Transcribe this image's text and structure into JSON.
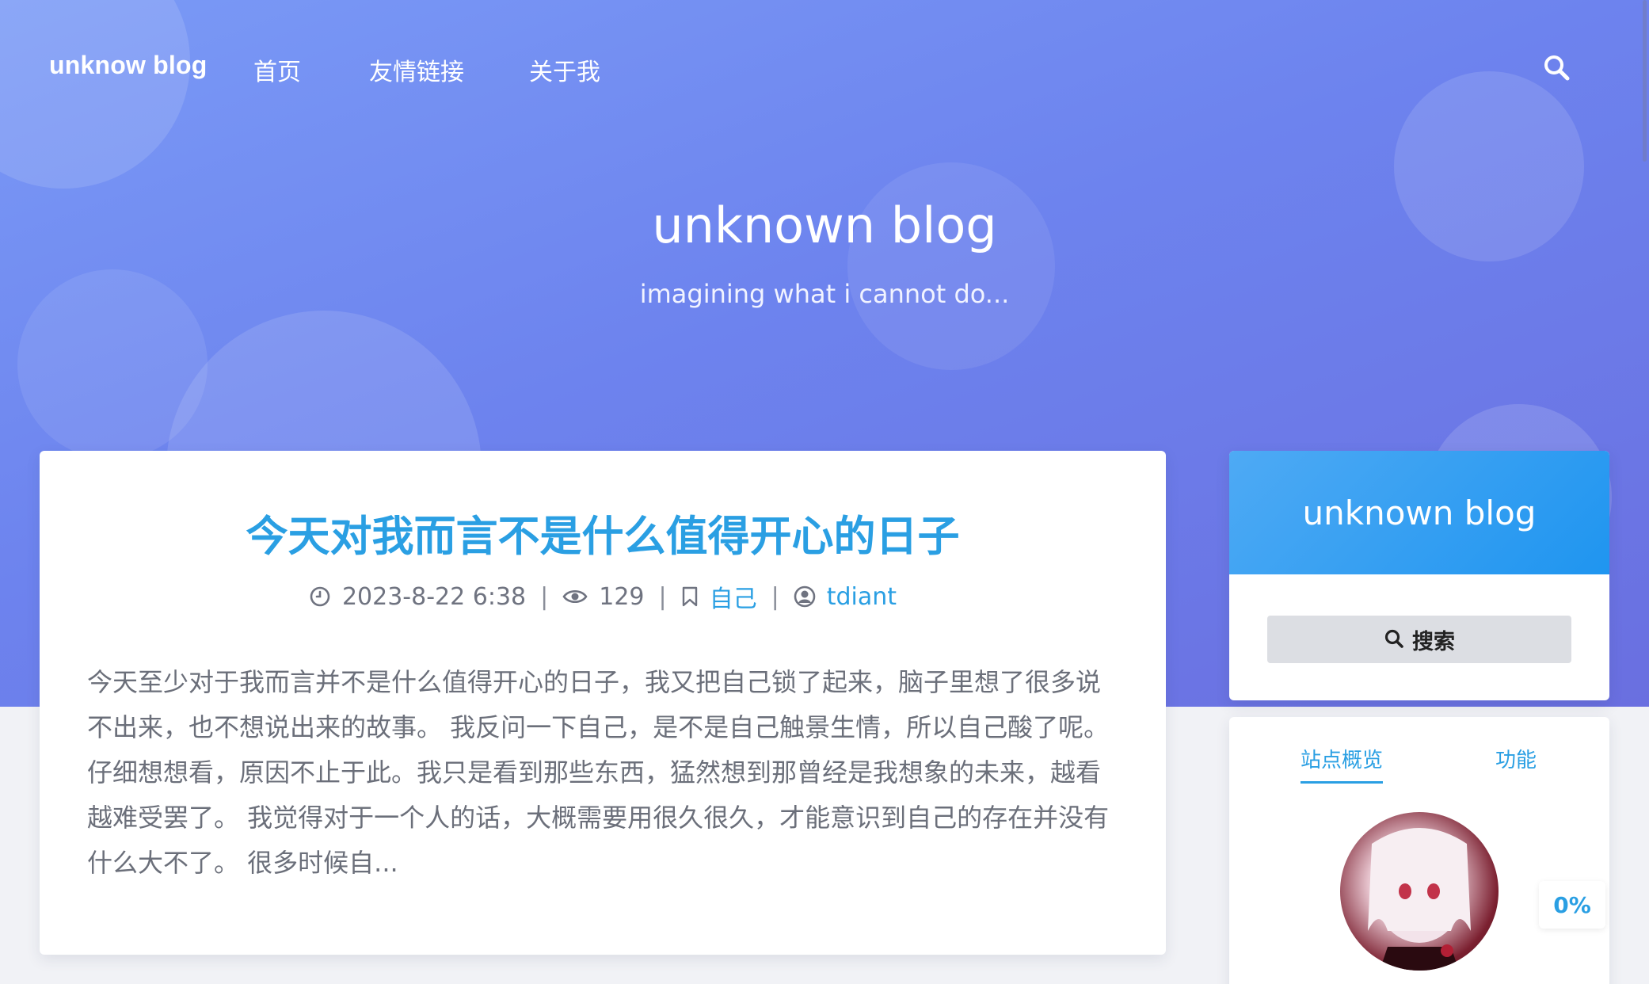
{
  "nav": {
    "brand": "unknow blog",
    "links": [
      "首页",
      "友情链接",
      "关于我"
    ]
  },
  "hero": {
    "title": "unknown blog",
    "subtitle": "imagining what i cannot do..."
  },
  "post": {
    "title": "今天对我而言不是什么值得开心的日子",
    "date": "2023-8-22 6:38",
    "views": "129",
    "category": "自己",
    "author": "tdiant",
    "separator": "|",
    "excerpt": "今天至少对于我而言并不是什么值得开心的日子，我又把自己锁了起来，脑子里想了很多说不出来，也不想说出来的故事。 我反问一下自己，是不是自己触景生情，所以自己酸了呢。仔细想想看，原因不止于此。我只是看到那些东西，猛然想到那曾经是我想象的未来，越看越难受罢了。 我觉得对于一个人的话，大概需要用很久很久，才能意识到自己的存在并没有什么大不了。 很多时候自..."
  },
  "sidebar": {
    "title": "unknown blog",
    "search_label": "搜索",
    "tabs": [
      "站点概览",
      "功能"
    ]
  },
  "progress": "0%",
  "colors": {
    "accent": "#2a9fe3",
    "hero_start": "#7a9af6",
    "hero_end": "#6a6fe0",
    "side_head": "#1f95f0"
  },
  "icons": {
    "nav_search": "search-icon",
    "date": "clock-icon",
    "views": "eye-icon",
    "category": "bookmark-icon",
    "author": "user-circle-icon"
  }
}
